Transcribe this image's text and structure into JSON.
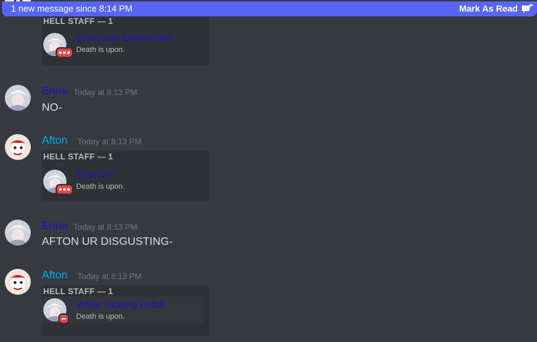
{
  "banner": {
    "text": "1 new message since 8:14 PM",
    "mark_read": "Mark As Read",
    "icon": "mark-read-icon"
  },
  "colors": {
    "background": "#36393f",
    "banner": "#5865f2",
    "enna": "#1a14c8",
    "afton": "#00b0f4",
    "timestamp": "#72767d",
    "text": "#dcddde",
    "embed_bg": "#2f3136",
    "dnd": "#ed4245"
  },
  "messages": [
    {
      "embed": {
        "title": "HELL STAFF — 1",
        "name": "Enna last fucked Ven",
        "activity": "Death is upon."
      }
    },
    {
      "author": "Enna",
      "timestamp": "Today at 8:13 PM",
      "text": "NO-"
    },
    {
      "author": "Afton",
      "timestamp": "Today at 8:13 PM",
      "embed": {
        "title": "HELL STAFF — 1",
        "name": "Then Ari",
        "activity": "Death is upon."
      }
    },
    {
      "author": "Enna",
      "timestamp": "Today at 8:13 PM",
      "text": "AFTON UR DISGUSTING-"
    },
    {
      "author": "Afton",
      "timestamp": "Today at 8:13 PM",
      "embed": {
        "title": "HELL STAFF — 1",
        "name": "While fucking Lolbit",
        "activity": "Death is upon."
      }
    }
  ]
}
